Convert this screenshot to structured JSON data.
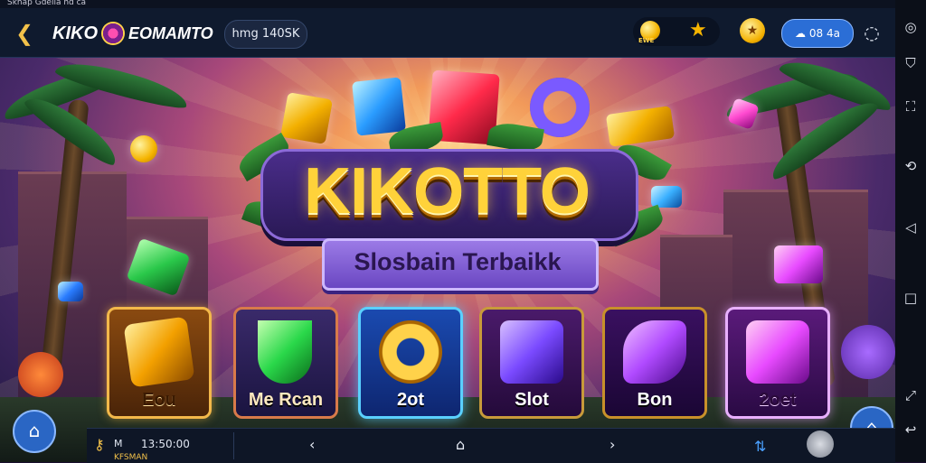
{
  "status_bar": {
    "text": "Skhap Gdelia hd ca"
  },
  "header": {
    "brand_left": "KIKO",
    "brand_right": "EOMAMTO",
    "user_pill": "hmg 140SK",
    "coin_caption": "EWE",
    "balance": "08 4a"
  },
  "hero": {
    "title": "KIKOTTO",
    "subtitle": "Slosbain Terbaikk"
  },
  "games": [
    {
      "label": "Eou",
      "icon": "amber-gem-icon"
    },
    {
      "label": "Me Rcan",
      "icon": "green-gem-icon"
    },
    {
      "label": "2ot",
      "icon": "gold-ring-icon"
    },
    {
      "label": "Slot",
      "icon": "purple-gem-icon"
    },
    {
      "label": "Bon",
      "icon": "violet-gem-icon"
    },
    {
      "label": "2oet",
      "icon": "magenta-gem-icon"
    }
  ],
  "bottom_bar": {
    "m_label": "M",
    "time": "13:50:00",
    "sub_text": "KFSMAN"
  },
  "colors": {
    "accent_gold": "#ffd23a",
    "accent_blue": "#2b6ed6",
    "banner_purple": "#6a47c2"
  }
}
